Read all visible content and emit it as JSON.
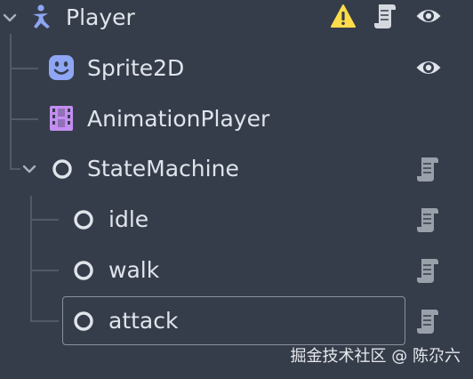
{
  "scene_tree": {
    "nodes": [
      {
        "label": "Player",
        "type_icon": "character-body-icon",
        "has_warning": true,
        "has_script": true,
        "visible_toggle": true
      },
      {
        "label": "Sprite2D",
        "type_icon": "sprite2d-icon",
        "visible_toggle": true
      },
      {
        "label": "AnimationPlayer",
        "type_icon": "animation-player-icon"
      },
      {
        "label": "StateMachine",
        "type_icon": "node-circle-icon",
        "has_script": true,
        "expanded": true
      },
      {
        "label": "idle",
        "type_icon": "node-circle-icon",
        "has_script": true
      },
      {
        "label": "walk",
        "type_icon": "node-circle-icon",
        "has_script": true
      },
      {
        "label": "attack",
        "type_icon": "node-circle-icon",
        "has_script": true,
        "selected": true
      }
    ]
  },
  "watermark": "掘金技术社区 @ 陈尕六",
  "colors": {
    "background": "#363d4a",
    "text": "#e0e4eb",
    "tree_line": "#525a68",
    "warning": "#ffdd4a",
    "sprite_icon": "#8ea6f4",
    "animation_icon": "#c38ef1",
    "character_icon": "#8da5f3",
    "script_icon": "#9aa0aa"
  }
}
